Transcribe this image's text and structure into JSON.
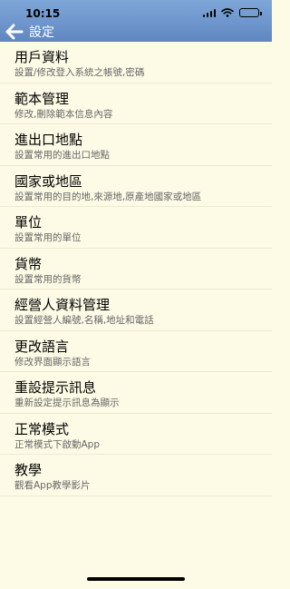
{
  "status": {
    "time": "10:15"
  },
  "nav": {
    "title": "設定",
    "back_icon": "arrow-left-icon"
  },
  "items": [
    {
      "title": "用戶資料",
      "subtitle": "設置/修改登入系統之帳號,密碼"
    },
    {
      "title": "範本管理",
      "subtitle": "修改,刪除範本信息內容"
    },
    {
      "title": "進出口地點",
      "subtitle": "設置常用的進出口地點"
    },
    {
      "title": "國家或地區",
      "subtitle": "設置常用的目的地,來源地,原產地國家或地區"
    },
    {
      "title": "單位",
      "subtitle": "設置常用的單位"
    },
    {
      "title": "貨幣",
      "subtitle": "設置常用的貨幣"
    },
    {
      "title": "經營人資料管理",
      "subtitle": "設置經營人編號,名稱,地址和電話"
    },
    {
      "title": "更改語言",
      "subtitle": "修改界面顯示語言"
    },
    {
      "title": "重設提示訊息",
      "subtitle": "重新設定提示訊息為顯示"
    },
    {
      "title": "正常模式",
      "subtitle": "正常模式下啟動App"
    },
    {
      "title": "教學",
      "subtitle": "觀看App教學影片"
    }
  ],
  "colors": {
    "background": "#fdfbe6",
    "nav_bar": "#6f97cd"
  }
}
